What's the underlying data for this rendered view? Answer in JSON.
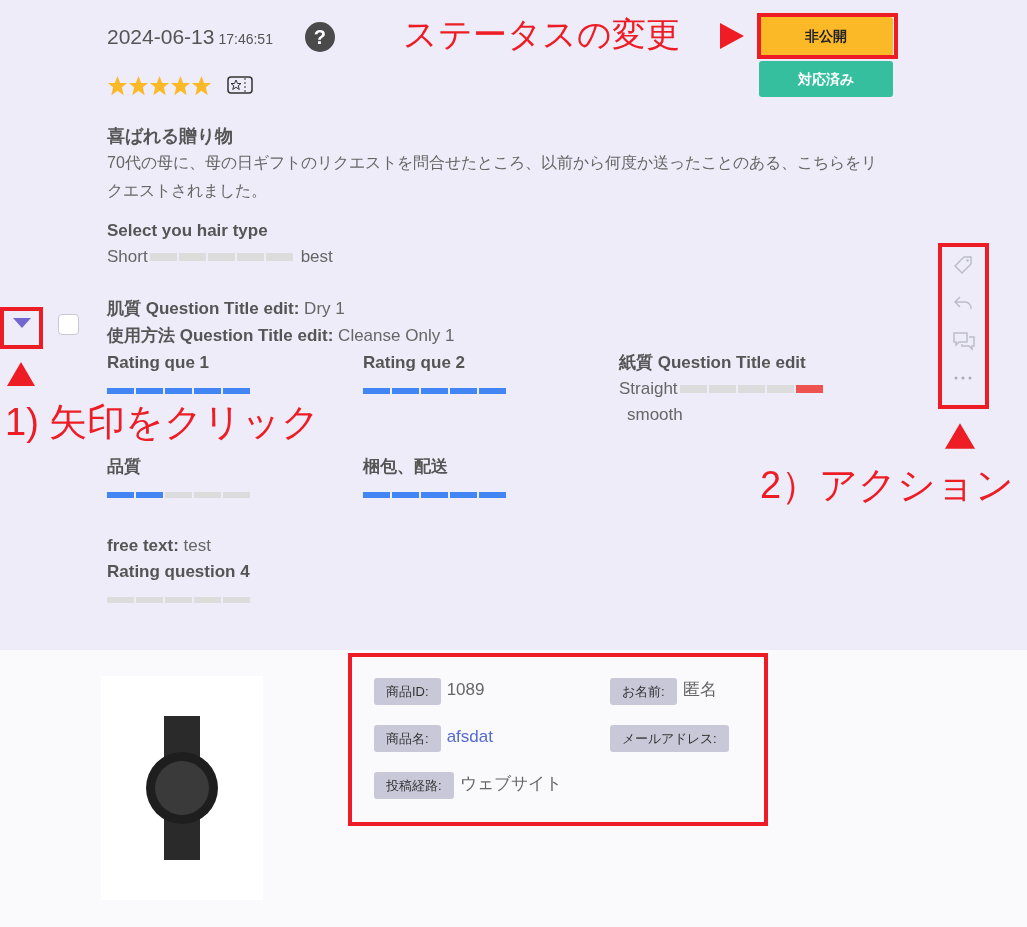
{
  "review": {
    "date": "2024-06-13",
    "time": "17:46:51",
    "help_icon": "?",
    "stars": 5,
    "checked": false,
    "title": "喜ばれる贈り物",
    "body": "70代の母に、母の日ギフトのリクエストを問合せたところ、以前から何度か送ったことのある、こちらをリクエストされました。"
  },
  "status_buttons": [
    {
      "label": "非公開",
      "kind": "unpublish"
    },
    {
      "label": "対応済み",
      "kind": "resolved"
    }
  ],
  "answers_top": [
    {
      "kind": "scale",
      "question": "Select you hair type",
      "left": "Short",
      "right": "best",
      "segments": [
        false,
        false,
        false,
        false,
        false
      ]
    },
    {
      "kind": "text",
      "question": "肌質 Question Title edit:",
      "answer": "Dry 1"
    },
    {
      "kind": "text",
      "question": "使用方法 Question Title edit:",
      "answer": "Cleanse Only 1"
    }
  ],
  "answer_grid": [
    {
      "kind": "rating",
      "question": "Rating que 1",
      "stars": 5
    },
    {
      "kind": "rating",
      "question": "Rating que 2",
      "stars": 5
    },
    {
      "kind": "scale",
      "question": "紙質 Question Title edit",
      "left": "Straight",
      "right": "smooth",
      "segments": [
        false,
        false,
        false,
        false,
        true
      ]
    },
    {
      "kind": "rating",
      "question": "品質",
      "stars": 2
    },
    {
      "kind": "rating",
      "question": "梱包、配送",
      "stars": 5
    }
  ],
  "answers_bottom": [
    {
      "kind": "text",
      "question": "free text:",
      "answer": "test"
    },
    {
      "kind": "rating",
      "question": "Rating question 4",
      "stars": 0
    }
  ],
  "product_fields": [
    {
      "label": "商品ID:",
      "value": "1089",
      "kind": "text"
    },
    {
      "label": "お名前:",
      "value": "匿名",
      "kind": "text"
    },
    {
      "label": "商品名:",
      "value": "afsdat",
      "kind": "link"
    },
    {
      "label": "メールアドレス:",
      "kind": "empty"
    },
    {
      "label": "投稿経路:",
      "value": "ウェブサイト",
      "kind": "text"
    }
  ],
  "annotations": {
    "status_label": "ステータスの変更",
    "step1": "1) 矢印をクリック",
    "step2": "2）アクション"
  }
}
